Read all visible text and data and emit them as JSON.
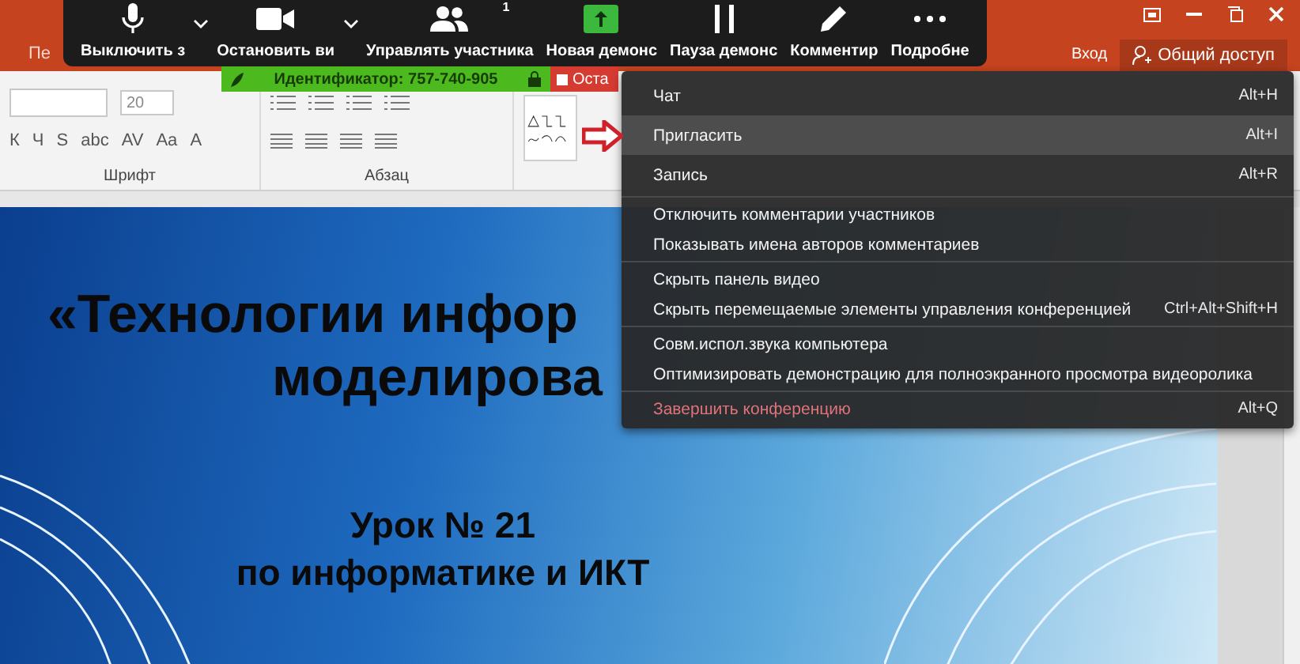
{
  "title_bar": {
    "tab_fragment": "Пе",
    "sign_in": "Вход",
    "share": "Общий доступ"
  },
  "meeting_toolbar": {
    "buttons": [
      {
        "kind": "mic",
        "label": "Выключить з",
        "caret": true
      },
      {
        "kind": "video",
        "label": "Остановить ви",
        "caret": true
      },
      {
        "kind": "participants",
        "label": "Управлять участника",
        "badge": "1",
        "caret": false
      },
      {
        "kind": "share",
        "label": "Новая демонс",
        "caret": false
      },
      {
        "kind": "pause",
        "label": "Пауза демонс",
        "caret": false
      },
      {
        "kind": "annotate",
        "label": "Комментир",
        "caret": false
      },
      {
        "kind": "more",
        "label": "Подробне",
        "caret": false
      }
    ]
  },
  "meeting_id_bar": {
    "text": "Идентификатор: 757-740-905",
    "stop_button": "Оста"
  },
  "ribbon": {
    "font_size": "20",
    "font_buttons": [
      "К",
      "Ч",
      "S",
      "abc",
      "AV",
      "Aa",
      "A"
    ],
    "groups": [
      "Шрифт",
      "Абзац"
    ]
  },
  "slide": {
    "title_lines": [
      "«Технологии инфор",
      "моделирова"
    ],
    "subtitle_lines": [
      "Урок № 21",
      "по информатике и ИКТ"
    ]
  },
  "menu": {
    "sections": [
      [
        {
          "label": "Чат",
          "shortcut": "Alt+H",
          "selected": false,
          "kind": "normal"
        },
        {
          "label": "Пригласить",
          "shortcut": "Alt+I",
          "selected": true,
          "kind": "normal"
        },
        {
          "label": "Запись",
          "shortcut": "Alt+R",
          "selected": false,
          "kind": "normal"
        }
      ],
      [
        {
          "label": "Отключить комментарии участников",
          "selected": false,
          "kind": "normal"
        },
        {
          "label": "Показывать имена авторов комментариев",
          "selected": false,
          "kind": "normal"
        }
      ],
      [
        {
          "label": "Скрыть панель видео",
          "selected": false,
          "kind": "normal"
        },
        {
          "label": "Скрыть перемещаемые элементы управления конференцией",
          "shortcut": "Ctrl+Alt+Shift+H",
          "selected": false,
          "kind": "normal"
        }
      ],
      [
        {
          "label": "Совм.испол.звука компьютера",
          "selected": false,
          "kind": "normal"
        },
        {
          "label": "Оптимизировать демонстрацию для полноэкранного просмотра видеоролика",
          "selected": false,
          "kind": "normal"
        }
      ],
      [
        {
          "label": "Завершить конференцию",
          "shortcut": "Alt+Q",
          "selected": false,
          "kind": "danger"
        }
      ]
    ]
  }
}
